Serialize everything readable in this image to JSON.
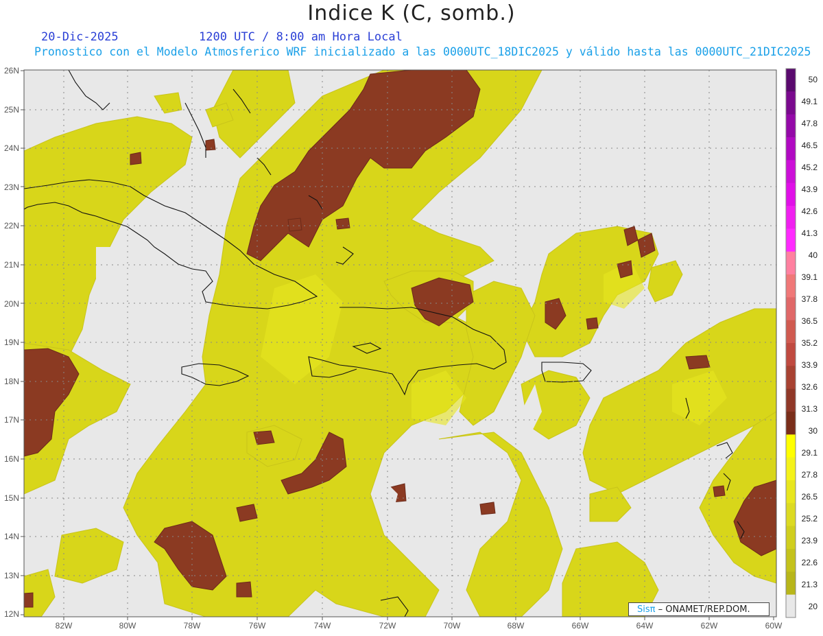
{
  "header": {
    "title": "Indice K (C, somb.)",
    "date": "20-Dic-2025",
    "time": "1200 UTC / 8:00 am Hora Local",
    "subtitle": "Pronostico con el Modelo Atmosferico WRF inicializado a las 0000UTC_18DIC2025 y válido hasta las  0000UTC_21DIC2025"
  },
  "map": {
    "lat_labels": [
      "26N",
      "25N",
      "24N",
      "23N",
      "22N",
      "21N",
      "20N",
      "19N",
      "18N",
      "17N",
      "16N",
      "15N",
      "14N",
      "13N",
      "12N"
    ],
    "lon_labels": [
      "82W",
      "80W",
      "78W",
      "76W",
      "74W",
      "72W",
      "70W",
      "68W",
      "66W",
      "64W",
      "62W",
      "60W"
    ],
    "background_color": "#e8e8e8"
  },
  "colorbar": {
    "labels": [
      "50",
      "49.1",
      "47.8",
      "46.5",
      "45.2",
      "43.9",
      "42.6",
      "41.3",
      "40",
      "39.1",
      "37.8",
      "36.5",
      "35.2",
      "33.9",
      "32.6",
      "31.3",
      "30",
      "29.1",
      "27.8",
      "26.5",
      "25.2",
      "23.9",
      "22.6",
      "21.3",
      "20"
    ],
    "colors": [
      "#5a0a6e",
      "#7a0a8e",
      "#940aa8",
      "#b00ac2",
      "#cc10d8",
      "#e010e8",
      "#f020f0",
      "#ff2aff",
      "#ff80a0",
      "#f07878",
      "#e06868",
      "#d05a50",
      "#c04a40",
      "#a84232",
      "#903828",
      "#7a2e1a",
      "#ffff00",
      "#f4f21a",
      "#e8e61e",
      "#dcda22",
      "#d0ce1e",
      "#c4c21c",
      "#b8b61a",
      "#e8e8e8"
    ]
  },
  "credit": {
    "sis": "Sisπ",
    "org": " – ONAMET/REP.DOM."
  }
}
